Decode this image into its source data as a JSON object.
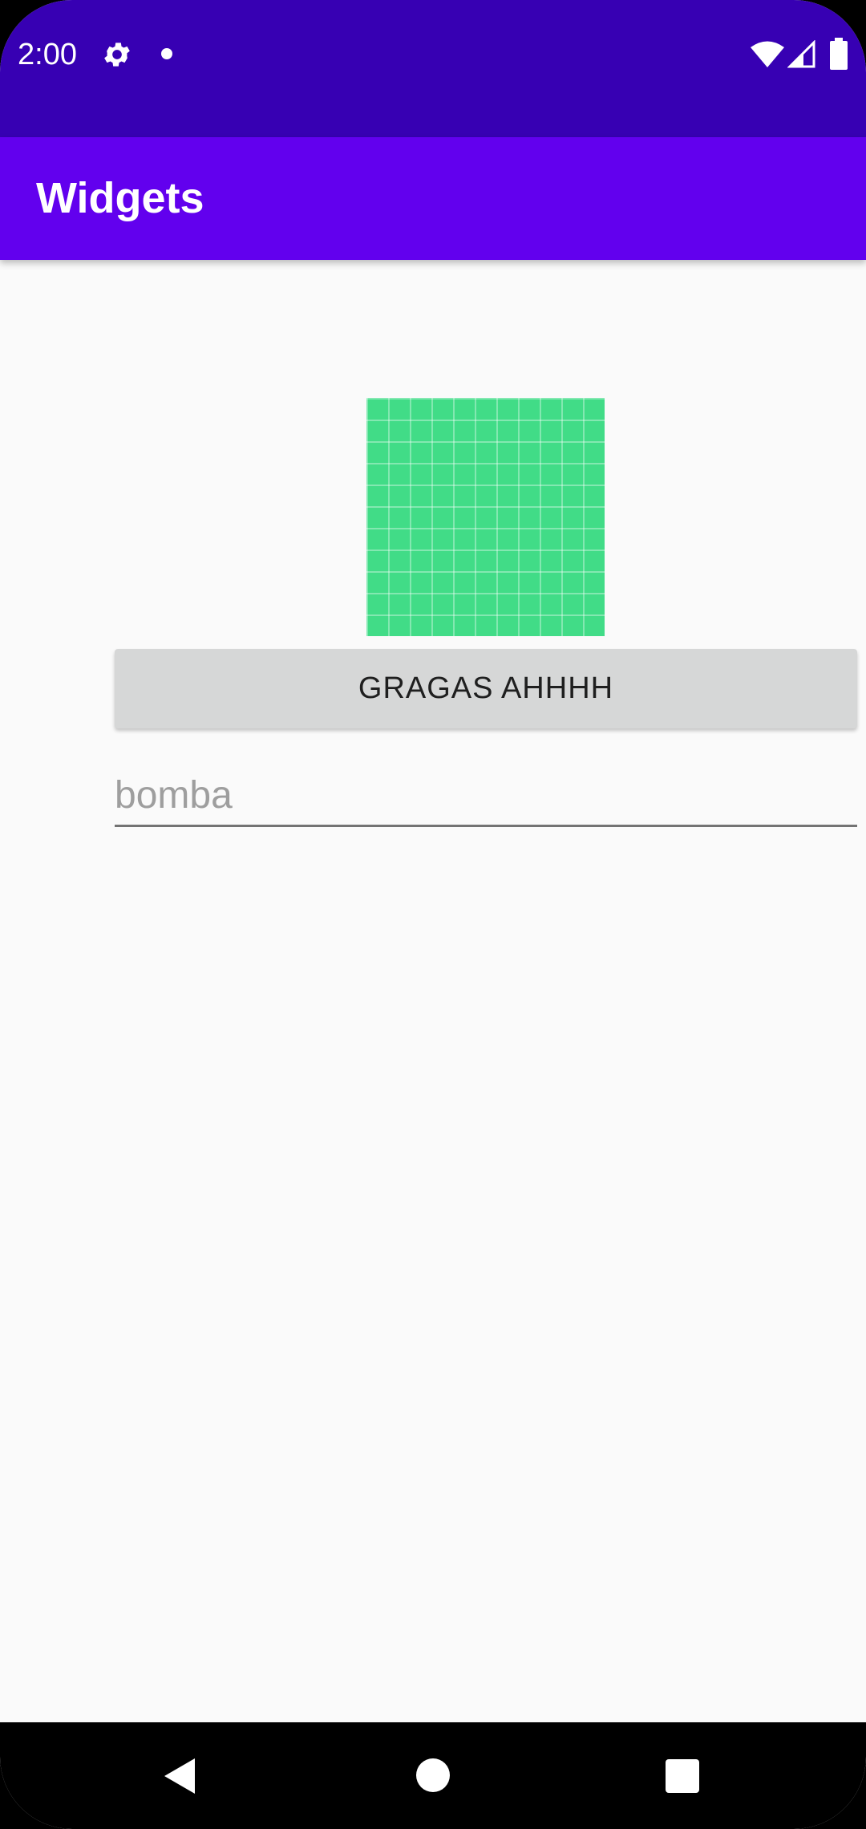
{
  "status_bar": {
    "time": "2:00",
    "icons": [
      "settings-gear-icon",
      "notification-dot-icon",
      "wifi-icon",
      "cell-signal-icon",
      "battery-icon"
    ]
  },
  "app_bar": {
    "title": "Widgets"
  },
  "main": {
    "image": {
      "description_icon": "green-grid-image"
    },
    "button_label": "GRAGAS AHHHH",
    "text_field": {
      "value": "",
      "placeholder": "bomba"
    }
  },
  "nav_bar": {
    "icons": [
      "back-icon",
      "home-icon",
      "recents-icon"
    ]
  },
  "colors": {
    "status_bar": "#3700b3",
    "app_bar": "#6200ee",
    "background": "#fafafa",
    "image_green": "#41dc87",
    "button_bg": "#d6d7d7"
  }
}
